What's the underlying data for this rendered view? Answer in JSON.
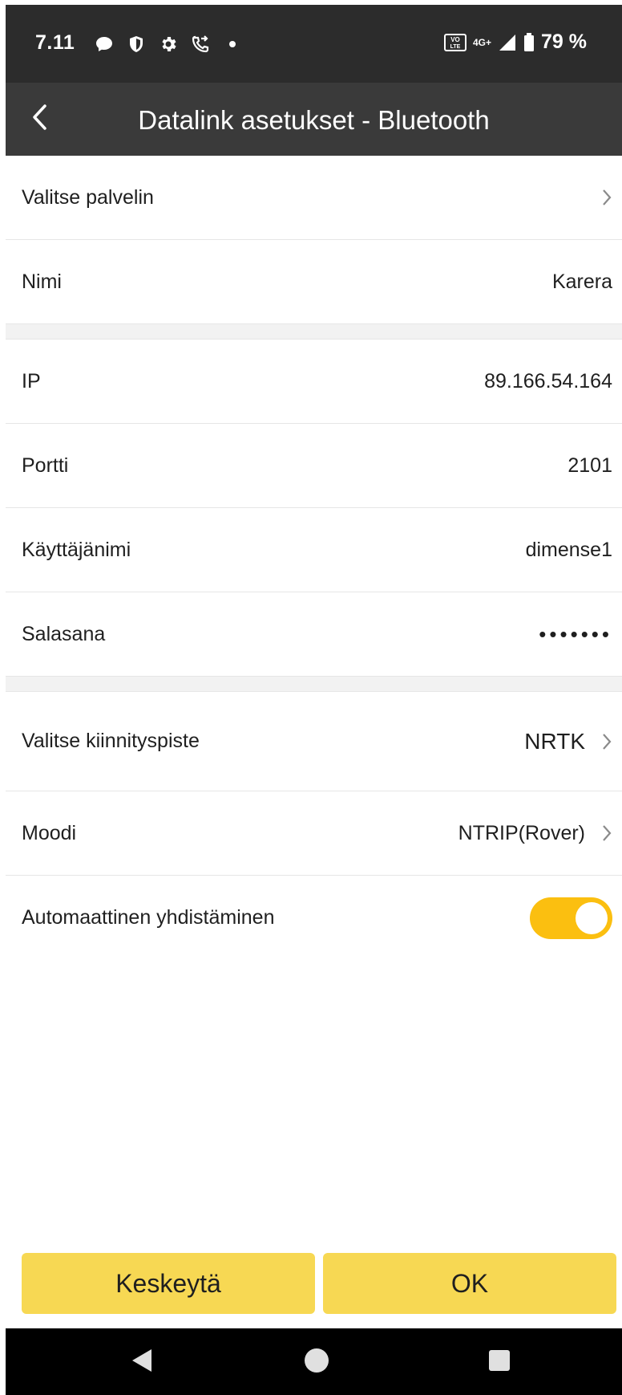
{
  "status_bar": {
    "time": "7.11",
    "battery": "79 %",
    "network": "4G+",
    "volte": "VoLTE",
    "icons": [
      "chat-icon",
      "shield-icon",
      "gear-icon",
      "call-forward-icon",
      "dot-icon",
      "volte-icon",
      "network-4g-icon",
      "signal-icon",
      "battery-icon"
    ]
  },
  "header": {
    "title": "Datalink asetukset - Bluetooth",
    "back_icon": "back-arrow-icon"
  },
  "rows": {
    "server": {
      "label": "Valitse palvelin",
      "value": ""
    },
    "name": {
      "label": "Nimi",
      "value": "Karera"
    },
    "ip": {
      "label": "IP",
      "value": "89.166.54.164"
    },
    "port": {
      "label": "Portti",
      "value": "2101"
    },
    "username": {
      "label": "Käyttäjänimi",
      "value": "dimense1"
    },
    "password": {
      "label": "Salasana",
      "value": "•••••••"
    },
    "mountpoint": {
      "label": "Valitse kiinnityspiste",
      "value": "NRTK"
    },
    "mode": {
      "label": "Moodi",
      "value": "NTRIP(Rover)"
    },
    "autoconnect": {
      "label": "Automaattinen yhdistäminen",
      "enabled": true
    }
  },
  "buttons": {
    "cancel": "Keskeytä",
    "ok": "OK"
  },
  "colors": {
    "status_bar": "#2c2c2c",
    "app_bar": "#3a3a3a",
    "toggle_on": "#fbbf10",
    "button": "#f7d853",
    "nav_bar": "#000000"
  }
}
